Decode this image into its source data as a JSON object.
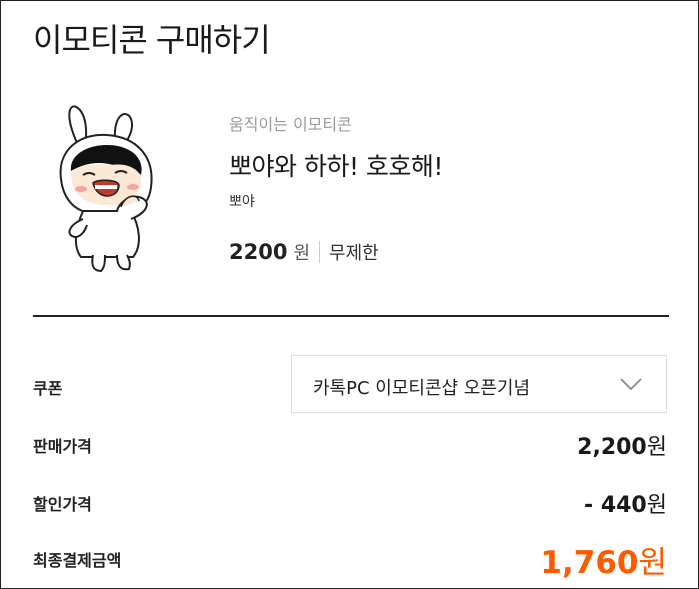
{
  "page": {
    "title": "이모티콘 구매하기"
  },
  "product": {
    "image_alt": "emoticon-character",
    "category": "움직이는 이모티콘",
    "name": "뽀야와 하하! 호호해!",
    "author": "뽀야",
    "price": "2200",
    "price_unit": "원",
    "period": "무제한"
  },
  "coupon": {
    "label": "쿠폰",
    "selected": "카톡PC 이모티콘샵 오픈기념",
    "icon": "chevron-down-icon"
  },
  "summary": {
    "sale_label": "판매가격",
    "sale_value": "2,200",
    "discount_label": "할인가격",
    "discount_value": "- 440",
    "final_label": "최종결제금액",
    "final_value": "1,760",
    "unit": "원"
  },
  "colors": {
    "accent": "#ff5a00",
    "text": "#1a1a1a",
    "muted": "#9a9a9a"
  }
}
